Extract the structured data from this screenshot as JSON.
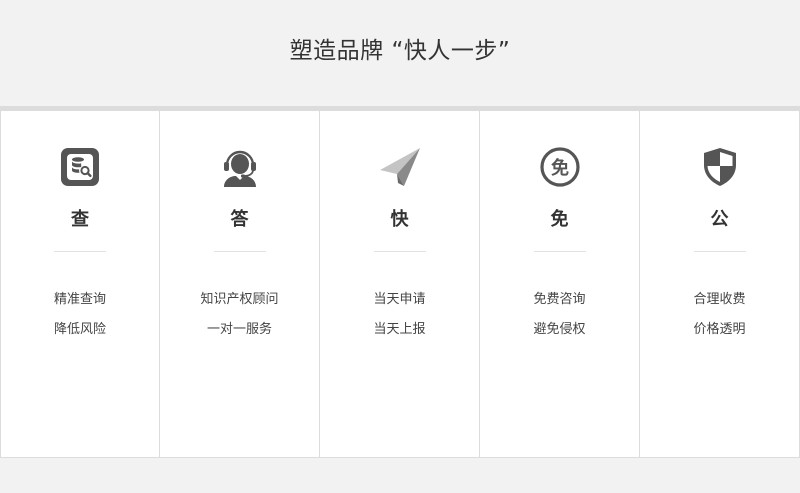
{
  "header": {
    "title": "塑造品牌 “快人一步”"
  },
  "cards": [
    {
      "icon": "database-search-icon",
      "title": "查",
      "lines": [
        "精准查询",
        "降低风险"
      ]
    },
    {
      "icon": "customer-service-headset-icon",
      "title": "答",
      "lines": [
        "知识产权顾问",
        "一对一服务"
      ]
    },
    {
      "icon": "paper-plane-icon",
      "title": "快",
      "lines": [
        "当天申请",
        "当天上报"
      ]
    },
    {
      "icon": "free-badge-icon",
      "title": "免",
      "lines": [
        "免费咨询",
        "避免侵权"
      ]
    },
    {
      "icon": "shield-icon",
      "title": "公",
      "lines": [
        "合理收费",
        "价格透明"
      ]
    }
  ],
  "colors": {
    "background": "#f2f2f2",
    "card": "#ffffff",
    "border": "#dcdcdc",
    "icon": "#555555",
    "text": "#333333"
  }
}
